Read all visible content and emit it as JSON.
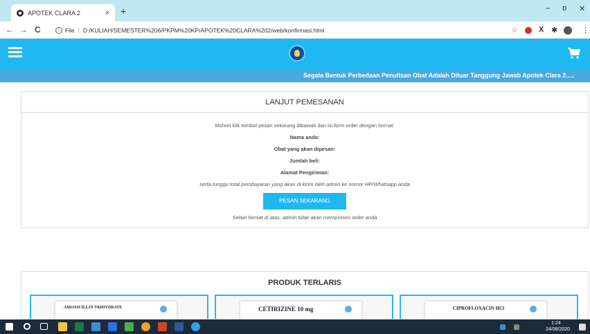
{
  "browser": {
    "tab_title": "APOTEK CLARA 2",
    "tab_close": "×",
    "new_tab": "+",
    "url_file": "File",
    "url": "D:/KULIAH/SEMESTER%206/PKPM%20KP/APOTEK%20CLARA%202/web/konfirmasi.html",
    "nav_back": "←",
    "nav_forward": "→",
    "nav_reload": "C",
    "info_icon": "ⓘ",
    "separator": "|",
    "star": "☆",
    "win_min": "–",
    "win_max": "ɒ",
    "win_close": "✕",
    "menu": "⋮"
  },
  "header": {
    "marquee": "Segala Bentuk Perbedaan Penulisan Obat Adalah Diluar Tanggung Jawab Apotek Clara 2....."
  },
  "order": {
    "title": "LANJUT PEMESANAN",
    "intro": "Mohon klik tombol pesan sekarang dibawah dan isi form order dengan format:",
    "field_name": "Nama anda:",
    "field_drug": "Obat yang akan dipesan:",
    "field_qty": "Jumlah beli:",
    "field_address": "Alamat Pengiriman:",
    "wait_note": "serta tunggu total pembayaran yang akan di kirim oleh admin ke nomor HP/Whatsapp anda",
    "button": "PESAN SEKARANG",
    "footer_note": "Selain format di atas, admin tidak akan memproses order anda"
  },
  "products": {
    "title": "PRODUK TERLARIS",
    "items": [
      {
        "brand": "AMOXICILLIN TRIHYDRATE"
      },
      {
        "brand": "CETIRIZINE 10 mg"
      },
      {
        "brand": "CIPROFLOXACIN HCl"
      }
    ]
  },
  "taskbar": {
    "time": "1:24",
    "date": "24/08/2020"
  },
  "colors": {
    "primary": "#1fb8f0",
    "marquee_bg": "#47a9de",
    "taskbar_bg": "#1c2b3a"
  }
}
